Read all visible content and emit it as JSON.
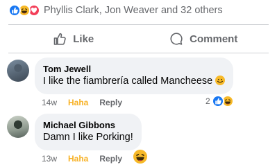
{
  "post": {
    "reactors_text": "Phyllis Clark, Jon Weaver and 32 others",
    "reaction_icons": [
      "like-icon",
      "haha-icon",
      "love-icon"
    ]
  },
  "actions": {
    "like_label": "Like",
    "comment_label": "Comment"
  },
  "comments": [
    {
      "author": "Tom Jewell",
      "text": "I like the fiambrería called Mancheese",
      "time": "14w",
      "haha_label": "Haha",
      "reply_label": "Reply",
      "reaction_count": "2",
      "reaction_icons": [
        "like-icon",
        "haha-icon"
      ]
    },
    {
      "author": "Michael Gibbons",
      "text": "Damn I like Porking!",
      "time": "13w",
      "haha_label": "Haha",
      "reply_label": "Reply",
      "reaction_icons": [
        "haha-icon"
      ]
    }
  ],
  "colors": {
    "like_blue": "#1877f2",
    "haha_yellow": "#f7b928",
    "love_red": "#f33e58",
    "secondary_text": "#65676b",
    "bubble_bg": "#f0f2f5"
  }
}
